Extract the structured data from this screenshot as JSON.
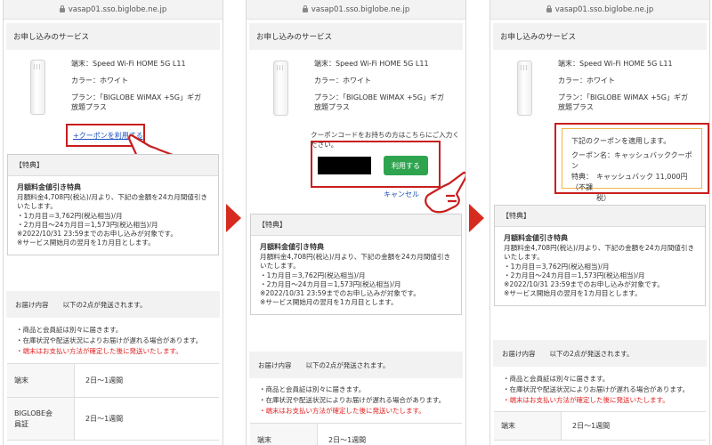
{
  "url": "vasap01.sso.biglobe.ne.jp",
  "service_title": "お申し込みのサービス",
  "product": {
    "terminal": "端末：Speed Wi-Fi HOME 5G L11",
    "color": "カラー：ホワイト",
    "plan_line1": "プラン：「BIGLOBE WiMAX +5G」ギガ",
    "plan_line2": "放題プラス"
  },
  "coupon_link": "+クーポンを利用する",
  "coupon_prompt_line1": "クーポンコードをお持ちの方はこちらにご入力く",
  "coupon_prompt_line2": "ださい。",
  "coupon_apply_button": "利用する",
  "coupon_cancel": "キャンセル",
  "coupon_applied": {
    "line1": "下記のクーポンを適用します。",
    "line2": "クーポン名：キャッシュバッククーポン",
    "line3": "特典：　キャッシュバック 11,000円（不課",
    "line4": "税）"
  },
  "tokuten": {
    "header": "【特典】",
    "title": "月額料金値引き特典",
    "lines": [
      "月額料金4,708円(税込)/月より、下記の金額を24カ月間値引き",
      "いたします。",
      "・1カ月目＝3,762円(税込相当)/月",
      "・2カ月目〜24カ月目＝1,573円(税込相当)/月",
      "※2022/10/31 23:59までのお申し込みが対象です。",
      "※サービス開始月の翌月を1カ月目とします。"
    ]
  },
  "delivery": {
    "label": "お届け内容",
    "summary": "以下の2点が発送されます。",
    "bullets": [
      "商品と会員証は別々に届きます。",
      "在庫状況や配送状況によりお届けが遅れる場合があります。",
      "端末はお支払い方法が確定した後に発送いたします。"
    ],
    "rows": [
      {
        "name": "端末",
        "period": "2日〜1週間"
      },
      {
        "name": "BIGLOBE会員証",
        "name_l1": "BIGLOBE会",
        "name_l2": "員証",
        "period": "2日〜1週間"
      }
    ]
  },
  "colors": {
    "arrow": "#d62b1e",
    "highlight": "#c81e1e",
    "button": "#2ea44f",
    "link": "#1a4fbf",
    "warning": "#e02020"
  }
}
